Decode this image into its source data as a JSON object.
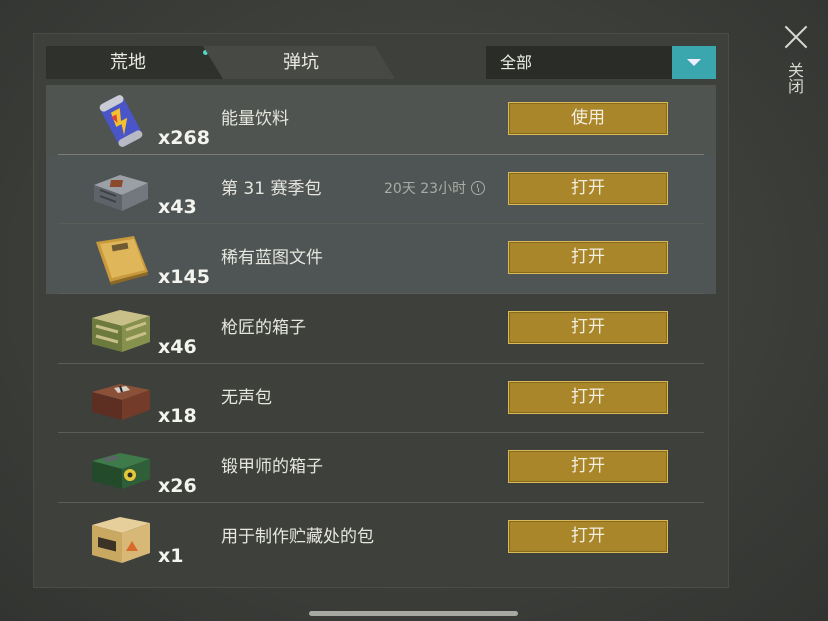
{
  "tabs": [
    {
      "label": "荒地",
      "active": true,
      "has_notification": true
    },
    {
      "label": "弹坑",
      "active": false
    }
  ],
  "filter": {
    "value": "全部"
  },
  "close": {
    "label": "关闭"
  },
  "items": [
    {
      "name": "能量饮料",
      "qty": "x268",
      "action": "使用",
      "timer": "",
      "icon": "energy-drink-can-icon"
    },
    {
      "name": "第 31 赛季包",
      "qty": "x43",
      "action": "打开",
      "timer": "20天 23小时",
      "icon": "season-pack-case-icon"
    },
    {
      "name": "稀有蓝图文件",
      "qty": "x145",
      "action": "打开",
      "timer": "",
      "icon": "blueprint-folder-icon"
    },
    {
      "name": "枪匠的箱子",
      "qty": "x46",
      "action": "打开",
      "timer": "",
      "icon": "gunsmith-crate-icon"
    },
    {
      "name": "无声包",
      "qty": "x18",
      "action": "打开",
      "timer": "",
      "icon": "silent-pack-box-icon"
    },
    {
      "name": "锻甲师的箱子",
      "qty": "x26",
      "action": "打开",
      "timer": "",
      "icon": "armorer-crate-icon"
    },
    {
      "name": "用于制作贮藏处的包",
      "qty": "x1",
      "action": "打开",
      "timer": "",
      "icon": "stash-pack-box-icon"
    }
  ],
  "colors": {
    "accent": "#3aa6ad",
    "action_button": "#a9862a",
    "panel": "#3e403b",
    "notification_dot": "#52d6c8"
  }
}
